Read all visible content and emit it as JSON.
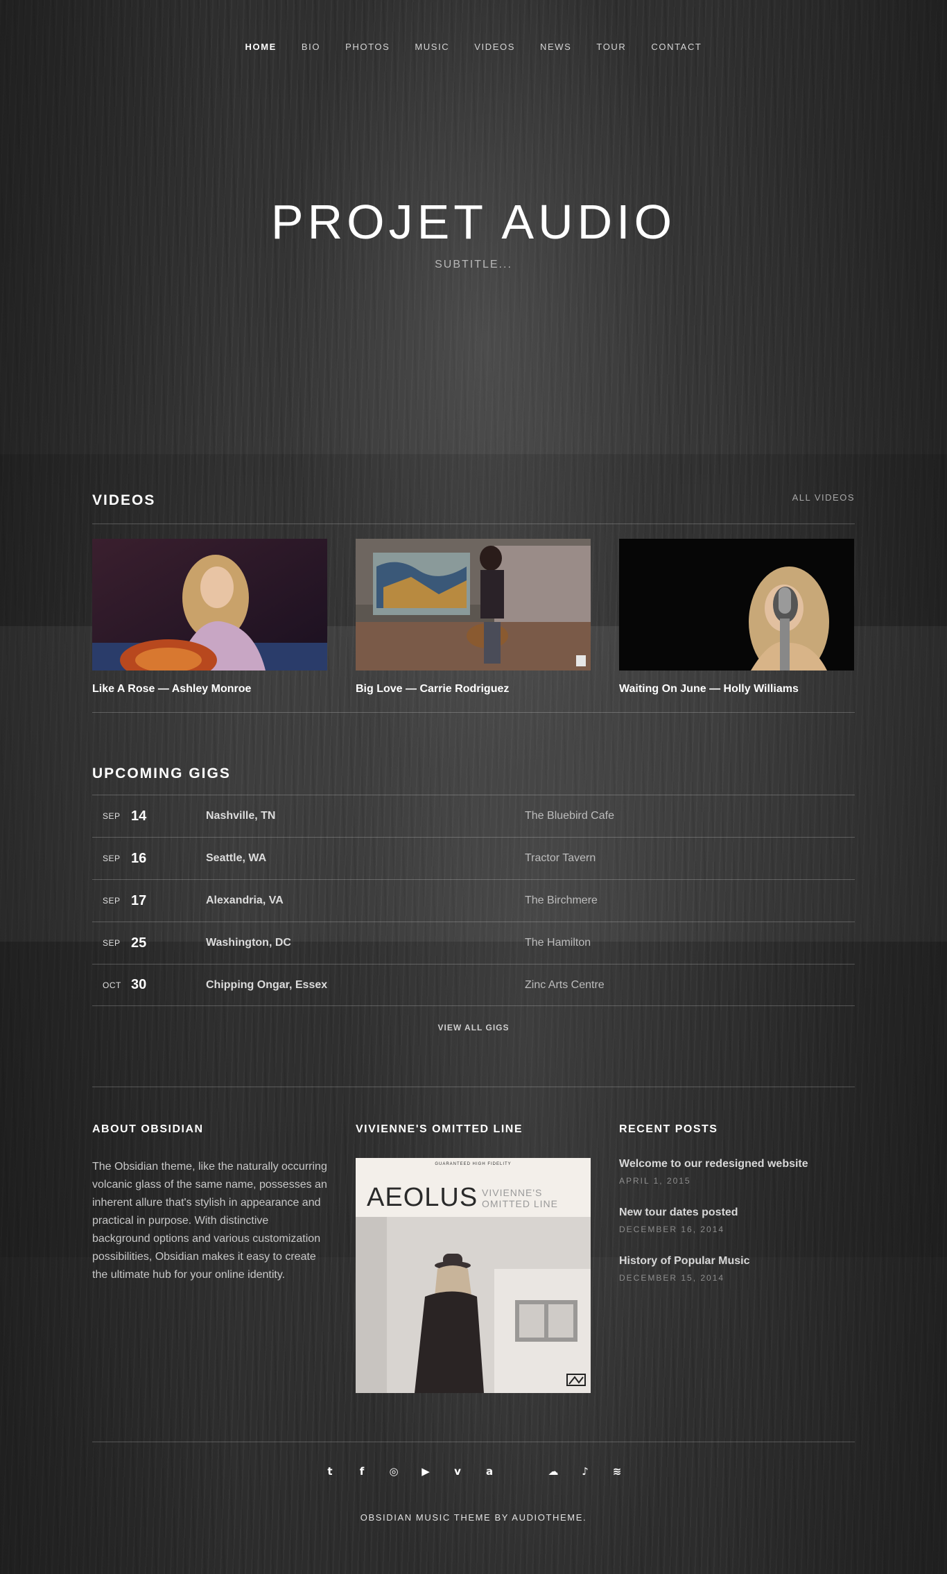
{
  "nav": {
    "items": [
      {
        "label": "HOME",
        "active": true
      },
      {
        "label": "BIO"
      },
      {
        "label": "PHOTOS"
      },
      {
        "label": "MUSIC"
      },
      {
        "label": "VIDEOS"
      },
      {
        "label": "NEWS"
      },
      {
        "label": "TOUR"
      },
      {
        "label": "CONTACT"
      }
    ]
  },
  "hero": {
    "title": "PROJET AUDIO",
    "subtitle": "SUBTITLE..."
  },
  "videos": {
    "title": "VIDEOS",
    "all_link": "ALL VIDEOS",
    "items": [
      {
        "title": "Like A Rose — Ashley Monroe"
      },
      {
        "title": "Big Love — Carrie Rodriguez"
      },
      {
        "title": "Waiting On June — Holly Williams"
      }
    ]
  },
  "gigs": {
    "title": "UPCOMING GIGS",
    "rows": [
      {
        "month": "SEP",
        "day": "14",
        "city": "Nashville, TN",
        "venue": "The Bluebird Cafe"
      },
      {
        "month": "SEP",
        "day": "16",
        "city": "Seattle, WA",
        "venue": "Tractor Tavern"
      },
      {
        "month": "SEP",
        "day": "17",
        "city": "Alexandria, VA",
        "venue": "The Birchmere"
      },
      {
        "month": "SEP",
        "day": "25",
        "city": "Washington, DC",
        "venue": "The Hamilton"
      },
      {
        "month": "OCT",
        "day": "30",
        "city": "Chipping Ongar, Essex",
        "venue": "Zinc Arts Centre"
      }
    ],
    "view_all": "VIEW ALL GIGS"
  },
  "about": {
    "title": "ABOUT OBSIDIAN",
    "text": "The Obsidian theme, like the naturally occurring volcanic glass of the same name, possesses an inherent allure that's stylish in appearance and practical in purpose. With distinctive background options and various customization possibilities, Obsidian makes it easy to create the ultimate hub for your online identity."
  },
  "album": {
    "title": "VIVIENNE'S OMITTED LINE",
    "cover_top": "GUARANTEED HIGH FIDELITY",
    "cover_name": "AEOLUS",
    "cover_sub_1": "VIVIENNE'S",
    "cover_sub_2": "OMITTED LINE"
  },
  "recent": {
    "title": "RECENT POSTS",
    "posts": [
      {
        "title": "Welcome to our redesigned website",
        "date": "APRIL 1, 2015"
      },
      {
        "title": "New tour dates posted",
        "date": "DECEMBER 16, 2014"
      },
      {
        "title": "History of Popular Music",
        "date": "DECEMBER 15, 2014"
      }
    ]
  },
  "social": [
    {
      "name": "twitter-icon",
      "glyph": "t"
    },
    {
      "name": "facebook-icon",
      "glyph": "f"
    },
    {
      "name": "instagram-icon",
      "glyph": "◎"
    },
    {
      "name": "youtube-icon",
      "glyph": "▶"
    },
    {
      "name": "vimeo-icon",
      "glyph": "v"
    },
    {
      "name": "amazon-icon",
      "glyph": "a"
    },
    {
      "name": "apple-icon",
      "glyph": ""
    },
    {
      "name": "soundcloud-icon",
      "glyph": "☁"
    },
    {
      "name": "itunes-icon",
      "glyph": "♪"
    },
    {
      "name": "spotify-icon",
      "glyph": "≋"
    }
  ],
  "footer": {
    "credit": "OBSIDIAN MUSIC THEME BY AUDIOTHEME."
  }
}
